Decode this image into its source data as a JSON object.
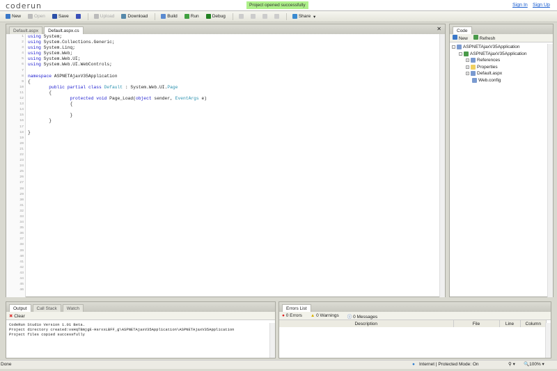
{
  "header": {
    "logo": "coderun",
    "toast": "Project opened successfully",
    "sign_in": "Sign In",
    "sign_up": "Sign Up"
  },
  "toolbar": [
    {
      "label": "New",
      "icon": "new-icon",
      "enabled": true,
      "color": "#3a78c8"
    },
    {
      "label": "Open",
      "icon": "open-icon",
      "enabled": false,
      "color": "#bbbbbb"
    },
    {
      "label": "Save",
      "icon": "save-icon",
      "enabled": true,
      "color": "#2a4fa8"
    },
    {
      "label": "",
      "icon": "save-all-icon",
      "enabled": true,
      "color": "#3a50b8"
    },
    {
      "label": "Upload",
      "icon": "upload-icon",
      "enabled": false,
      "color": "#bbbbbb"
    },
    {
      "label": "Download",
      "icon": "download-icon",
      "enabled": true,
      "color": "#5588aa"
    },
    {
      "label": "Build",
      "icon": "build-icon",
      "enabled": true,
      "color": "#5a8ad0"
    },
    {
      "label": "Run",
      "icon": "run-icon",
      "enabled": true,
      "color": "#40a040"
    },
    {
      "label": "Debug",
      "icon": "debug-icon",
      "enabled": true,
      "color": "#208020"
    },
    {
      "label": "",
      "icon": "stop-icon",
      "enabled": false,
      "color": "#cccccc"
    },
    {
      "label": "",
      "icon": "step-into-icon",
      "enabled": false,
      "color": "#cccccc"
    },
    {
      "label": "",
      "icon": "step-over-icon",
      "enabled": false,
      "color": "#cccccc"
    },
    {
      "label": "",
      "icon": "step-out-icon",
      "enabled": false,
      "color": "#cccccc"
    },
    {
      "label": "Share",
      "icon": "share-icon",
      "enabled": true,
      "color": "#3a8ad0"
    }
  ],
  "editor": {
    "tabs": [
      "Default.aspx",
      "Default.aspx.cs"
    ],
    "active_tab": 1,
    "line_count": 46,
    "lines": [
      "using System;",
      "using System.Collections.Generic;",
      "using System.Linq;",
      "using System.Web;",
      "using System.Web.UI;",
      "using System.Web.UI.WebControls;",
      "",
      "namespace ASPNETAjaxV35Application",
      "{",
      "        public partial class Default : System.Web.UI.Page",
      "        {",
      "                protected void Page_Load(object sender, EventArgs e)",
      "                {",
      "",
      "                }",
      "        }",
      "",
      "}"
    ]
  },
  "code_panel": {
    "tab": "Code",
    "new": "New",
    "refresh": "Refresh",
    "tree": [
      {
        "label": "ASPNETAjaxV35Application",
        "depth": 0,
        "exp": "-",
        "icon": "solution-icon"
      },
      {
        "label": "ASPNETAjaxV35Application",
        "depth": 1,
        "exp": "-",
        "icon": "project-icon"
      },
      {
        "label": "References",
        "depth": 2,
        "exp": "+",
        "icon": "references-icon"
      },
      {
        "label": "Properties",
        "depth": 2,
        "exp": "+",
        "icon": "folder-icon"
      },
      {
        "label": "Default.aspx",
        "depth": 2,
        "exp": "+",
        "icon": "aspx-file-icon"
      },
      {
        "label": "Web.config",
        "depth": 2,
        "exp": "",
        "icon": "config-file-icon"
      }
    ]
  },
  "output": {
    "tabs": [
      "Output",
      "Call Stack",
      "Watch"
    ],
    "clear": "Clear",
    "text": "CodeRun Studio Version 1.01 Beta.\nProject directory created:vsHqTBmjgE-HsrxxLBFF_g\\ASPNETAjaxV35Application\\ASPNETAjaxV35Application\nProject files copied successfully"
  },
  "errors": {
    "tab": "Errors List",
    "errors": "0 Errors",
    "warnings": "0 Warnings",
    "messages": "0 Messages",
    "columns": [
      "Description",
      "File",
      "Line",
      "Column"
    ]
  },
  "status": {
    "left": "Done",
    "zone": "Internet | Protected Mode: On",
    "zoom": "100%"
  }
}
